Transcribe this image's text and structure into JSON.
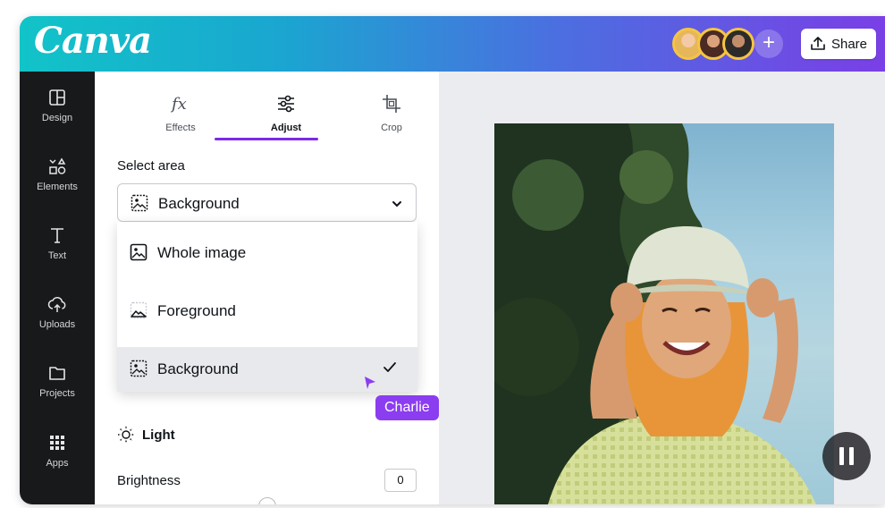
{
  "app": {
    "logo": "Canva",
    "brand_gradient": [
      "#11c4c8",
      "#4b6fe0",
      "#7a3fe6"
    ]
  },
  "header": {
    "collaborators": [
      "collaborator-1",
      "collaborator-2",
      "collaborator-3"
    ],
    "add_label": "+",
    "share_label": "Share",
    "share_icon": "upload-icon"
  },
  "sidebar": {
    "items": [
      {
        "label": "Design",
        "icon": "layout-icon"
      },
      {
        "label": "Elements",
        "icon": "shapes-icon"
      },
      {
        "label": "Text",
        "icon": "text-icon"
      },
      {
        "label": "Uploads",
        "icon": "cloud-upload-icon"
      },
      {
        "label": "Projects",
        "icon": "folder-icon"
      },
      {
        "label": "Apps",
        "icon": "grid-icon"
      }
    ]
  },
  "panel": {
    "tabs": [
      {
        "label": "Effects",
        "icon": "fx-icon"
      },
      {
        "label": "Adjust",
        "icon": "sliders-icon",
        "active": true
      },
      {
        "label": "Crop",
        "icon": "crop-icon"
      }
    ],
    "select_area_label": "Select area",
    "select_area_value": "Background",
    "options": [
      {
        "label": "Whole image",
        "icon": "image-icon"
      },
      {
        "label": "Foreground",
        "icon": "foreground-icon"
      },
      {
        "label": "Background",
        "icon": "background-icon",
        "selected": true
      }
    ],
    "light_label": "Light",
    "brightness_label": "Brightness",
    "brightness_value": "0",
    "brightness_level": 0.5
  },
  "cursor": {
    "name": "Charlie",
    "color": "#8b3df0"
  },
  "canvas": {
    "accent": "#7d2ae8"
  }
}
